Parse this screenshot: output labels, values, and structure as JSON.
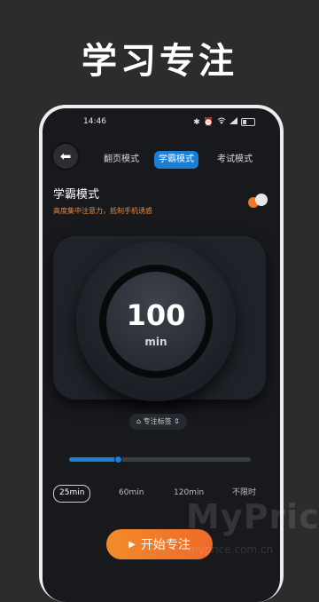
{
  "headline": "学习专注",
  "status": {
    "time": "14:46"
  },
  "tabs": [
    {
      "label": "翻页模式",
      "active": false
    },
    {
      "label": "学霸模式",
      "active": true
    },
    {
      "label": "考试模式",
      "active": false
    }
  ],
  "mode": {
    "title": "学霸模式",
    "description": "高度集中注意力，抵制手机诱惑"
  },
  "dial": {
    "value": "100",
    "unit": "min"
  },
  "tag_chip": {
    "label": "专注标签"
  },
  "slider": {
    "fraction": 0.27
  },
  "presets": [
    {
      "label": "25min",
      "active": true
    },
    {
      "label": "60min",
      "active": false
    },
    {
      "label": "120min",
      "active": false
    },
    {
      "label": "不限时",
      "active": false
    }
  ],
  "start_button": {
    "label": "开始专注"
  },
  "watermark": {
    "text": "MyPrice",
    "sub": "myprice.com.cn"
  },
  "colors": {
    "accent_blue": "#1b7fd6",
    "accent_orange": "#f0762a",
    "background": "#18191d"
  }
}
